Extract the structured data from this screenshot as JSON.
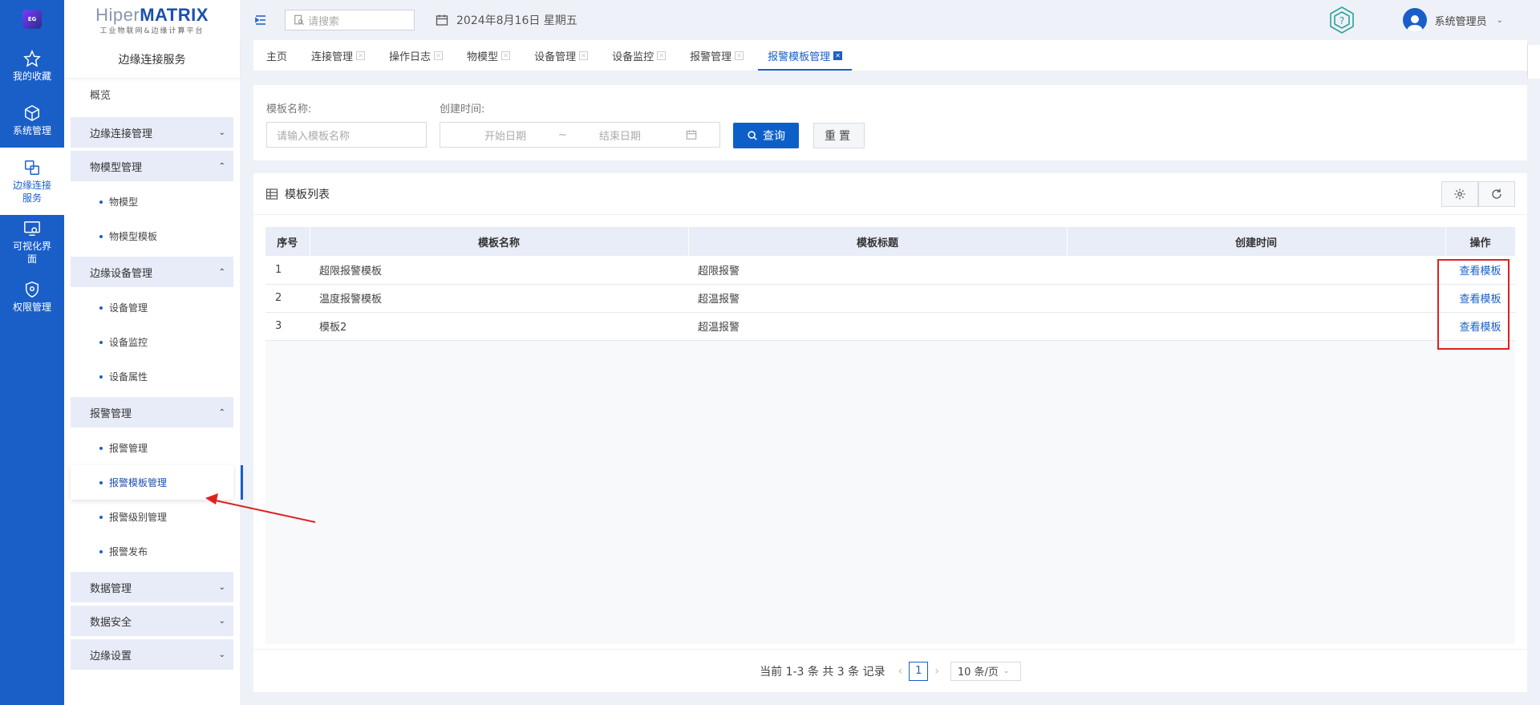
{
  "rail": {
    "logo_text": "EG",
    "items": [
      {
        "label": "我的收藏"
      },
      {
        "label": "系统管理"
      },
      {
        "label": "边缘连接服务"
      },
      {
        "label": "可视化界面"
      },
      {
        "label": "权限管理"
      }
    ]
  },
  "brand": {
    "name_prefix": "Hiper",
    "name_suffix": "MATRIX",
    "tagline": "工业物联网&边缘计算平台"
  },
  "sidebar": {
    "title": "边缘连接服务",
    "overview": "概览",
    "groups": [
      {
        "label": "边缘连接管理",
        "items": []
      },
      {
        "label": "物模型管理",
        "items": [
          "物模型",
          "物模型模板"
        ]
      },
      {
        "label": "边缘设备管理",
        "items": [
          "设备管理",
          "设备监控",
          "设备属性"
        ]
      },
      {
        "label": "报警管理",
        "items": [
          "报警管理",
          "报警模板管理",
          "报警级别管理",
          "报警发布"
        ]
      },
      {
        "label": "数据管理",
        "items": []
      },
      {
        "label": "数据安全",
        "items": []
      },
      {
        "label": "边缘设置",
        "items": []
      }
    ]
  },
  "header": {
    "search_placeholder": "请搜索",
    "date": "2024年8月16日 星期五",
    "user": "系统管理员"
  },
  "tabs": [
    {
      "label": "主页",
      "closable": false
    },
    {
      "label": "连接管理",
      "closable": true
    },
    {
      "label": "操作日志",
      "closable": true
    },
    {
      "label": "物模型",
      "closable": true
    },
    {
      "label": "设备管理",
      "closable": true
    },
    {
      "label": "设备监控",
      "closable": true
    },
    {
      "label": "报警管理",
      "closable": true
    },
    {
      "label": "报警模板管理",
      "closable": true,
      "active": true
    }
  ],
  "filter": {
    "name_label": "模板名称:",
    "name_placeholder": "请输入模板名称",
    "time_label": "创建时间:",
    "start_placeholder": "开始日期",
    "range_sep": "~",
    "end_placeholder": "结束日期",
    "query_label": "查询",
    "reset_label": "重置"
  },
  "list": {
    "title": "模板列表",
    "columns": [
      "序号",
      "模板名称",
      "模板标题",
      "创建时间",
      "操作"
    ],
    "rows": [
      {
        "no": "1",
        "name": "超限报警模板",
        "title": "超限报警",
        "created": "",
        "action": "查看模板"
      },
      {
        "no": "2",
        "name": "温度报警模板",
        "title": "超温报警",
        "created": "",
        "action": "查看模板"
      },
      {
        "no": "3",
        "name": "模板2",
        "title": "超温报警",
        "created": "",
        "action": "查看模板"
      }
    ]
  },
  "pager": {
    "summary": "当前 1-3 条 共 3 条 记录",
    "current_page": "1",
    "page_size": "10 条/页"
  },
  "colors": {
    "primary": "#1a5fc8",
    "highlight": "#e02020"
  }
}
